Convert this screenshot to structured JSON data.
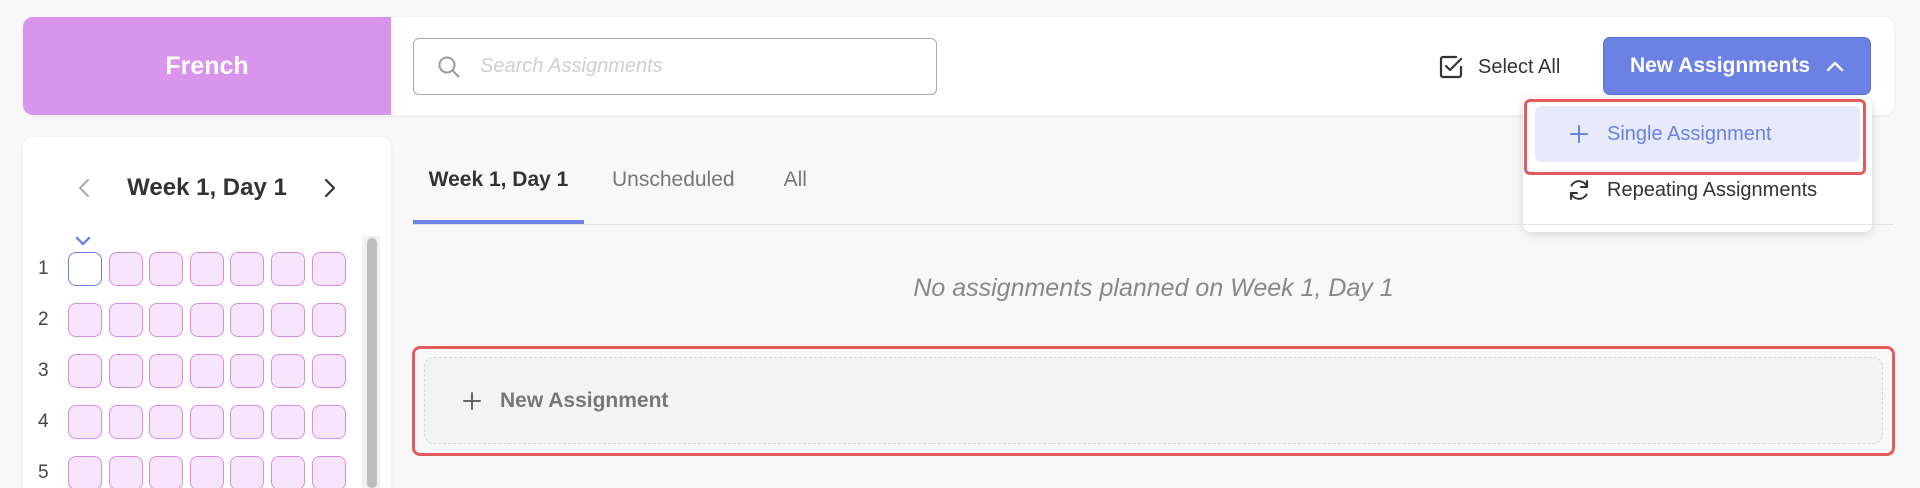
{
  "header": {
    "subject": "French",
    "search_placeholder": "Search Assignments",
    "select_all_label": "Select All",
    "new_assignments_label": "New Assignments"
  },
  "dropdown": {
    "items": [
      {
        "label": "Single Assignment",
        "icon": "plus-icon"
      },
      {
        "label": "Repeating Assignments",
        "icon": "refresh-icon"
      }
    ]
  },
  "calendar": {
    "week_label": "Week 1, Day 1",
    "rows": [
      "1",
      "2",
      "3",
      "4",
      "5"
    ]
  },
  "tabs": [
    {
      "label": "Week 1, Day 1",
      "active": true
    },
    {
      "label": "Unscheduled",
      "active": false
    },
    {
      "label": "All",
      "active": false
    }
  ],
  "main": {
    "empty_message": "No assignments planned on Week 1, Day 1",
    "new_assignment_label": "New Assignment"
  },
  "colors": {
    "subject": "#d994ec",
    "accent": "#6b81e3",
    "highlight": "#e45b5b",
    "cell_fill": "#f6e5fb",
    "cell_border": "#d98be9"
  }
}
